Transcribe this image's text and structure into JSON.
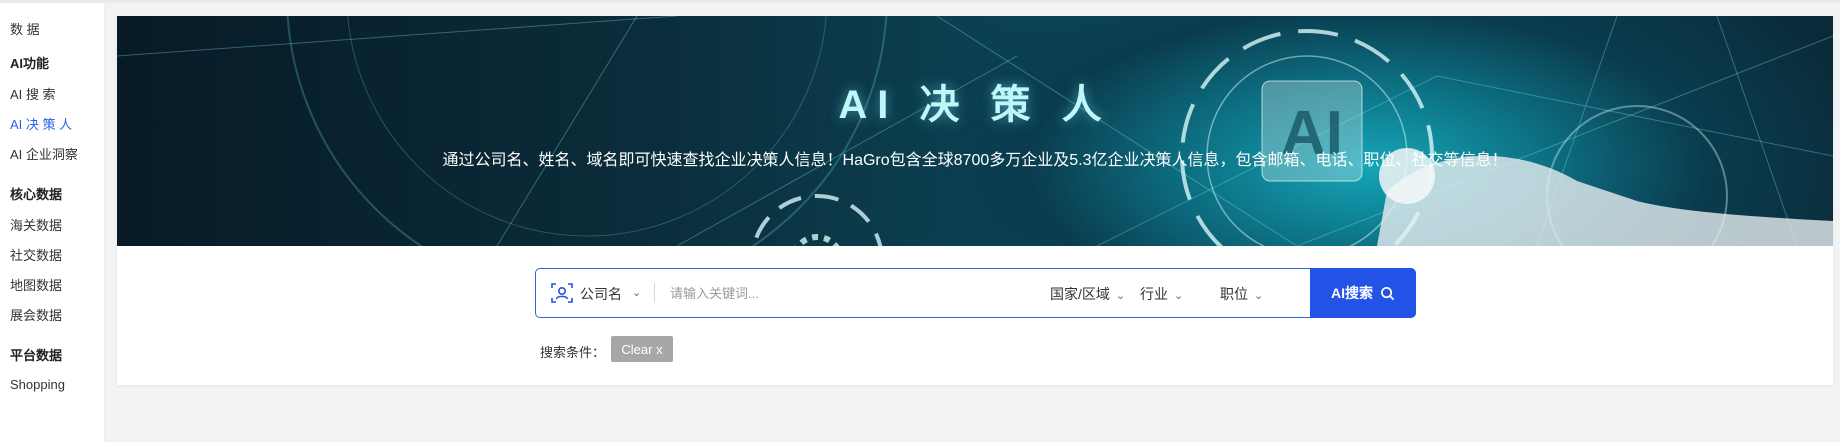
{
  "sidebar": {
    "items": [
      {
        "label": "数 据",
        "type": "item"
      },
      {
        "label": "AI功能",
        "type": "group"
      },
      {
        "label": "AI 搜 索",
        "type": "item"
      },
      {
        "label": "AI 决 策 人",
        "type": "item",
        "active": true
      },
      {
        "label": "AI 企业洞察",
        "type": "item"
      },
      {
        "label": "核心数据",
        "type": "group"
      },
      {
        "label": "海关数据",
        "type": "item"
      },
      {
        "label": "社交数据",
        "type": "item"
      },
      {
        "label": "地图数据",
        "type": "item"
      },
      {
        "label": "展会数据",
        "type": "item"
      },
      {
        "label": "平台数据",
        "type": "group"
      },
      {
        "label": "Shopping",
        "type": "item"
      }
    ]
  },
  "banner": {
    "title": "AI 决 策 人",
    "subtitle": "通过公司名、姓名、域名即可快速查找企业决策人信息！HaGro包含全球8700多万企业及5.3亿企业决策人信息，包含邮箱、电话、职位、社交等信息！",
    "art_text": "AI"
  },
  "search": {
    "type_label": "公司名",
    "placeholder": "请输入关键词...",
    "value": "",
    "filters": {
      "country": "国家/区域",
      "industry": "行业",
      "position": "职位"
    },
    "button_label": "AI搜索"
  },
  "conditions": {
    "label": "搜索条件：",
    "clear_label": "Clear x"
  },
  "colors": {
    "accent": "#2253e6",
    "active_nav": "#2a62e8",
    "banner_dark": "#0b2c3a",
    "banner_glow": "#14a6b8",
    "clear_button": "#a7a7a7"
  }
}
